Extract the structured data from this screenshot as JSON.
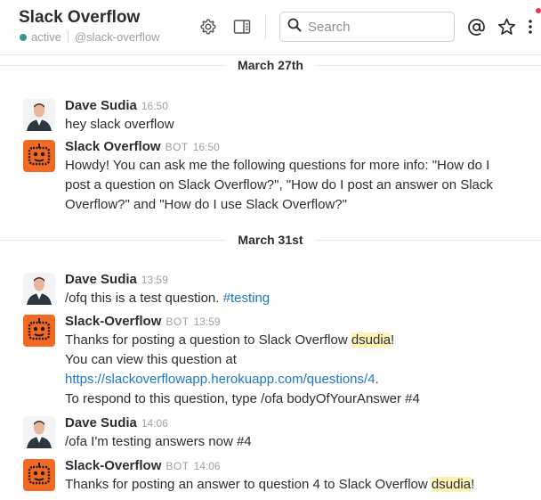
{
  "header": {
    "channel_title": "Slack Overflow",
    "status": "active",
    "handle": "@slack-overflow",
    "search_placeholder": "Search",
    "icons": [
      "gear-icon",
      "sidebar-toggle-icon",
      "search-icon",
      "mention-icon",
      "star-icon",
      "more-vertical-icon"
    ]
  },
  "colors": {
    "active_dot": "#38978d",
    "link": "#1d78c2",
    "highlight": "#fff3b8",
    "bot_avatar": "#f26a22",
    "notification": "#e8384f"
  },
  "days": [
    {
      "label": "March 27th"
    },
    {
      "label": "March 31st"
    }
  ],
  "messages": [
    {
      "sender": "Dave Sudia",
      "time": "16:50",
      "line1": "hey slack overflow"
    },
    {
      "sender": "Slack Overflow",
      "bot": "BOT",
      "time": "16:50",
      "line1": "Howdy! You can ask me the following questions for more info: \"How do I",
      "line2": "post a question on Slack Overflow?\", \"How do I post an answer on Slack",
      "line3": "Overflow?\" and \"How do I use Slack Overflow?\""
    },
    {
      "sender": "Dave Sudia",
      "time": "13:59",
      "text": "/ofq this is a test question. ",
      "hashtag": "#testing"
    },
    {
      "sender": "Slack-Overflow",
      "bot": "BOT",
      "time": "13:59",
      "line1_pre": "Thanks for posting a question to Slack Overflow ",
      "mention": "dsudia",
      "line1_post": "!",
      "line2": "You can view this question at",
      "link": "https://slackoverflowapp.herokuapp.com/questions/4",
      "link_post": ".",
      "line4": "To respond to this question, type /ofa bodyOfYourAnswer #4"
    },
    {
      "sender": "Dave Sudia",
      "time": "14:06",
      "line1": "/ofa I'm testing answers now #4"
    },
    {
      "sender": "Slack-Overflow",
      "bot": "BOT",
      "time": "14:06",
      "line1_pre": "Thanks for posting an answer to question 4 to Slack Overflow ",
      "mention": "dsudia",
      "line1_post": "!"
    }
  ]
}
